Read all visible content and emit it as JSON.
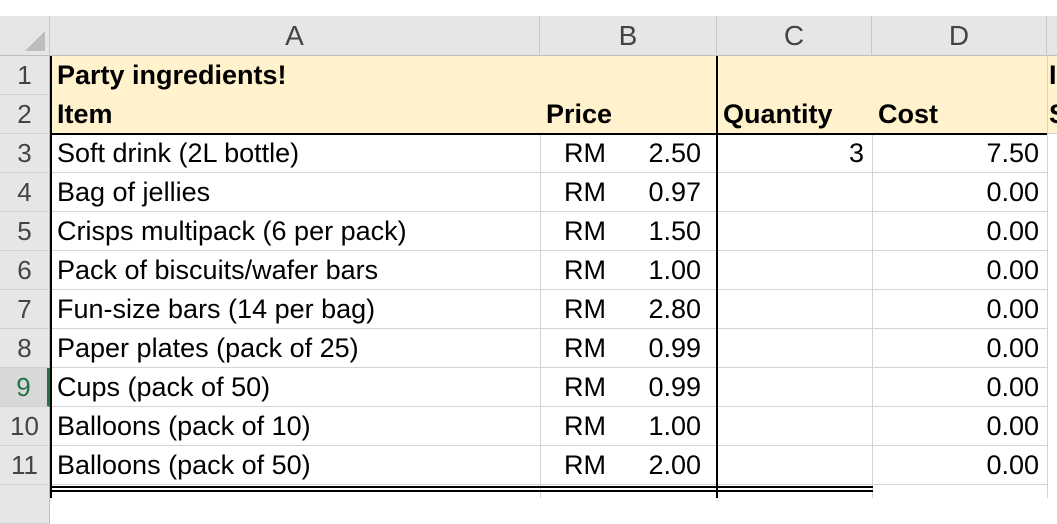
{
  "columns": [
    "A",
    "B",
    "C",
    "D"
  ],
  "rows": [
    "1",
    "2",
    "3",
    "4",
    "5",
    "6",
    "7",
    "8",
    "9",
    "10",
    "11"
  ],
  "selected_row": "9",
  "title": "Party ingredients!",
  "headers": {
    "item": "Item",
    "price": "Price",
    "quantity": "Quantity",
    "cost": "Cost"
  },
  "col_e_peek": {
    "row1": "I",
    "row2": "S"
  },
  "items": [
    {
      "item": "Soft drink (2L bottle)",
      "currency": "RM",
      "price": "2.50",
      "quantity": "3",
      "cost": "7.50"
    },
    {
      "item": "Bag of jellies",
      "currency": "RM",
      "price": "0.97",
      "quantity": "",
      "cost": "0.00"
    },
    {
      "item": "Crisps multipack (6 per pack)",
      "currency": "RM",
      "price": "1.50",
      "quantity": "",
      "cost": "0.00"
    },
    {
      "item": "Pack of biscuits/wafer bars",
      "currency": "RM",
      "price": "1.00",
      "quantity": "",
      "cost": "0.00"
    },
    {
      "item": "Fun-size bars (14 per bag)",
      "currency": "RM",
      "price": "2.80",
      "quantity": "",
      "cost": "0.00"
    },
    {
      "item": "Paper plates (pack of 25)",
      "currency": "RM",
      "price": "0.99",
      "quantity": "",
      "cost": "0.00"
    },
    {
      "item": "Cups (pack of 50)",
      "currency": "RM",
      "price": "0.99",
      "quantity": "",
      "cost": "0.00"
    },
    {
      "item": "Balloons (pack of 10)",
      "currency": "RM",
      "price": "1.00",
      "quantity": "",
      "cost": "0.00"
    },
    {
      "item": "Balloons (pack of 50)",
      "currency": "RM",
      "price": "2.00",
      "quantity": "",
      "cost": "0.00"
    }
  ],
  "colors": {
    "header_fill": "#fff2cc",
    "selection": "#217346",
    "header_bg": "#e6e6e6"
  }
}
